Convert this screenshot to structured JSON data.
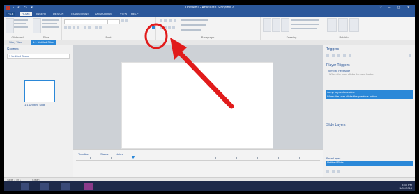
{
  "window": {
    "title": "Untitled1 - Articulate Storyline 2"
  },
  "ribbon": {
    "tabs": [
      "FILE",
      "HOME",
      "INSERT",
      "DESIGN",
      "TRANSITIONS",
      "ANIMATIONS",
      "VIEW",
      "HELP"
    ],
    "groups": [
      "Clipboard",
      "Slide",
      "Font",
      "Paragraph",
      "Drawing",
      "Publish"
    ],
    "buttons": {
      "paste": "Paste",
      "new_slide": "New Slide",
      "preview": "Preview",
      "publish": "Publish"
    }
  },
  "view_tabs": [
    "Story View",
    "1.1 Untitled Slide"
  ],
  "scenes": {
    "title": "Scenes",
    "dropdown": "1 Untitled Scene",
    "thumb_label": "1.1 Untitled Slide"
  },
  "timeline": {
    "tabs": [
      "Timeline",
      "States",
      "Notes"
    ]
  },
  "triggers": {
    "title": "Triggers",
    "player_triggers_label": "Player Triggers",
    "row1": "Jump to next slide",
    "row1_detail": "When the user clicks the next button",
    "row2": "Jump to previous slide",
    "row2_detail": "When the user clicks the previous button"
  },
  "slide_layers": {
    "title": "Slide Layers",
    "base_layer": "Base Layer",
    "layer1": "Untitled Slide"
  },
  "statusbar": {
    "left": "Slide 1 of 1",
    "right": "Clean"
  },
  "taskbar": {
    "time": "3:35 PM",
    "date": "1/31/2014"
  },
  "colors": {
    "accent": "#2b579a",
    "selection": "#2b88d8",
    "annotation": "#e11b1b"
  }
}
